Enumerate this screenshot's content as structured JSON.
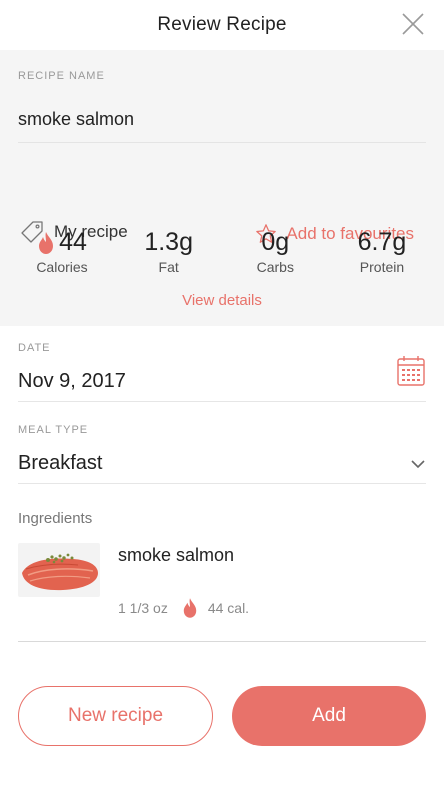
{
  "header": {
    "title": "Review Recipe",
    "close_icon": "close-icon"
  },
  "recipe": {
    "name_label": "RECIPE NAME",
    "name_value": "smoke salmon",
    "my_recipe_label": "My recipe",
    "favourites_label": "Add to favourites",
    "view_details": "View details"
  },
  "nutrients": [
    {
      "value": "44",
      "caption": "Calories"
    },
    {
      "value": "1.3g",
      "caption": "Fat"
    },
    {
      "value": "0g",
      "caption": "Carbs"
    },
    {
      "value": "6.7g",
      "caption": "Protein"
    }
  ],
  "date": {
    "label": "DATE",
    "value": "Nov 9, 2017",
    "icon": "calendar-icon"
  },
  "meal_type": {
    "label": "MEAL TYPE",
    "value": "Breakfast",
    "icon": "chevron-down-icon"
  },
  "ingredients": {
    "label": "Ingredients",
    "items": [
      {
        "name": "smoke salmon",
        "amount": "1 1/3 oz",
        "calories": "44 cal."
      }
    ]
  },
  "buttons": {
    "new_recipe": "New recipe",
    "add": "Add"
  },
  "colors": {
    "accent": "#e8726a",
    "gray_bg": "#f5f5f5"
  }
}
